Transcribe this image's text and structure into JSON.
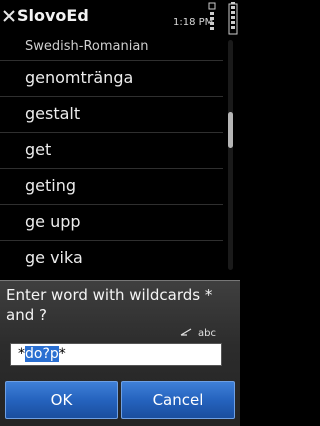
{
  "status_bar": {
    "app_title": "SlovoEd",
    "time": "1:18 PM"
  },
  "list": {
    "header": "Swedish-Romanian",
    "items": [
      {
        "label": "genomtränga"
      },
      {
        "label": "gestalt"
      },
      {
        "label": "get"
      },
      {
        "label": "geting"
      },
      {
        "label": "ge upp"
      },
      {
        "label": "ge vika"
      }
    ]
  },
  "dialog": {
    "title": "Enter word with wildcards * and ?",
    "input_mode": "abc",
    "field": {
      "prefix": "*",
      "selected": "do?p",
      "suffix": "*"
    },
    "ok_label": "OK",
    "cancel_label": "Cancel"
  },
  "icons": [
    "close-icon",
    "signal-icon",
    "battery-icon",
    "pen-icon"
  ]
}
